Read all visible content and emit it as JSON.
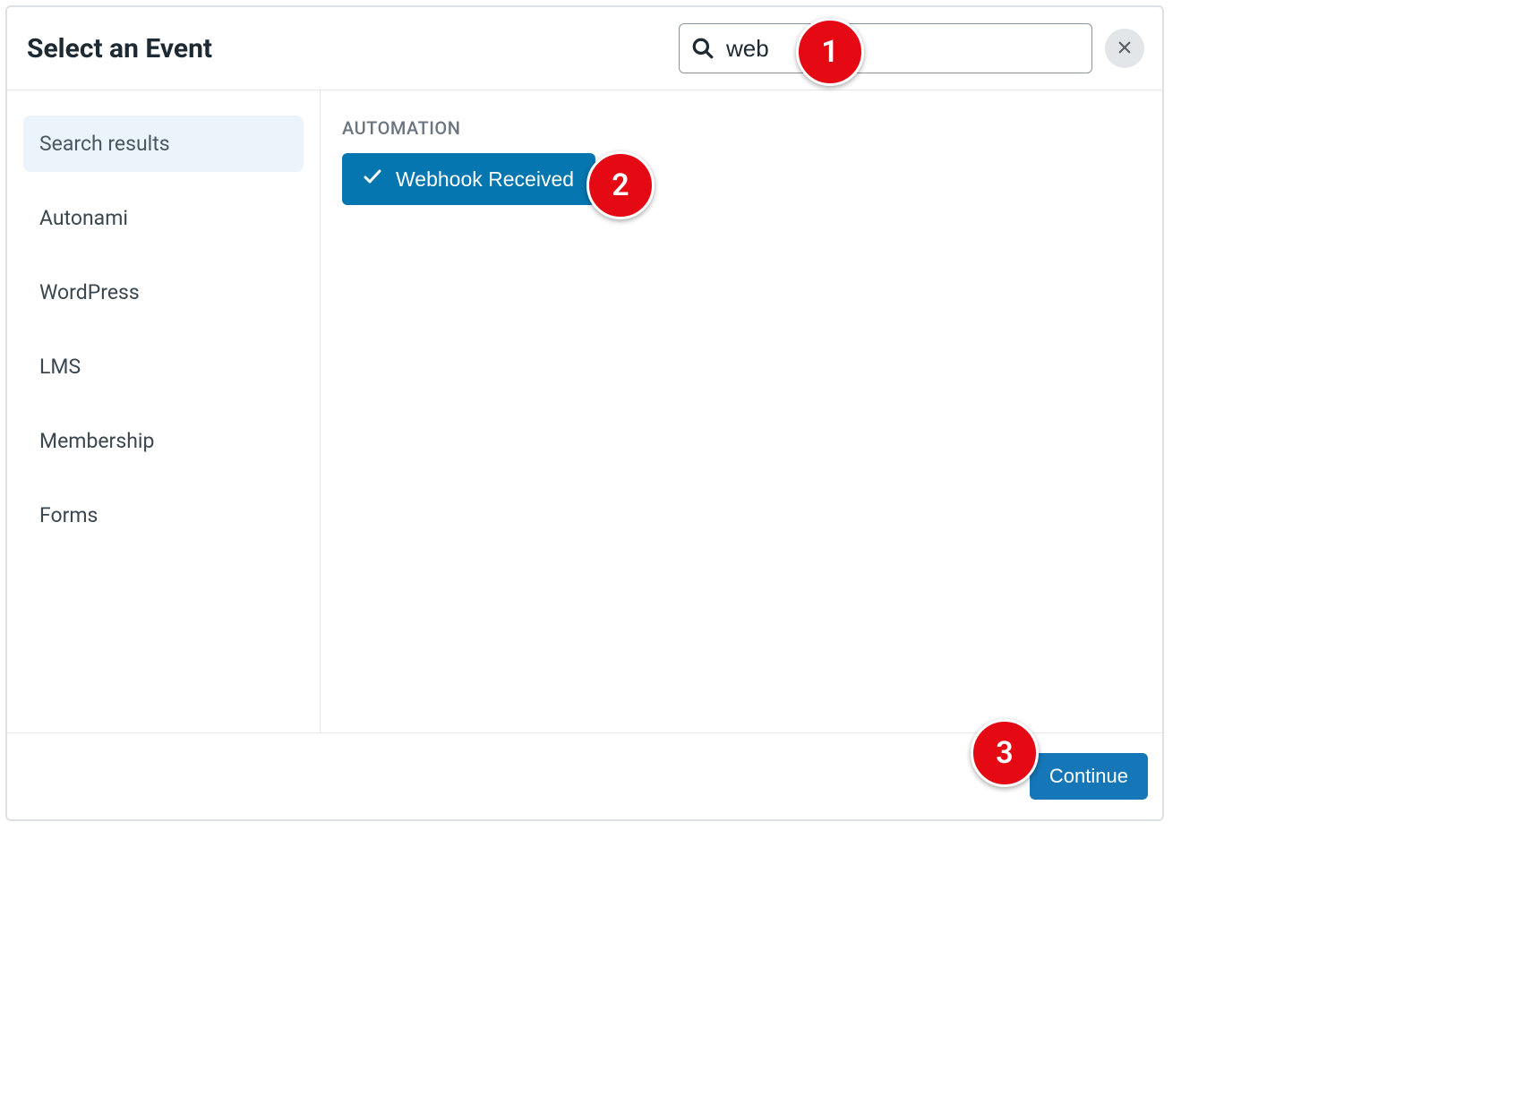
{
  "header": {
    "title": "Select an Event",
    "search_value": "web",
    "search_placeholder": ""
  },
  "sidebar": {
    "items": [
      {
        "label": "Search results",
        "active": true
      },
      {
        "label": "Autonami",
        "active": false
      },
      {
        "label": "WordPress",
        "active": false
      },
      {
        "label": "LMS",
        "active": false
      },
      {
        "label": "Membership",
        "active": false
      },
      {
        "label": "Forms",
        "active": false
      }
    ]
  },
  "main": {
    "section_label": "AUTOMATION",
    "events": [
      {
        "label": "Webhook Received",
        "selected": true
      }
    ]
  },
  "footer": {
    "continue_label": "Continue"
  },
  "annotations": [
    {
      "num": "1"
    },
    {
      "num": "2"
    },
    {
      "num": "3"
    }
  ]
}
